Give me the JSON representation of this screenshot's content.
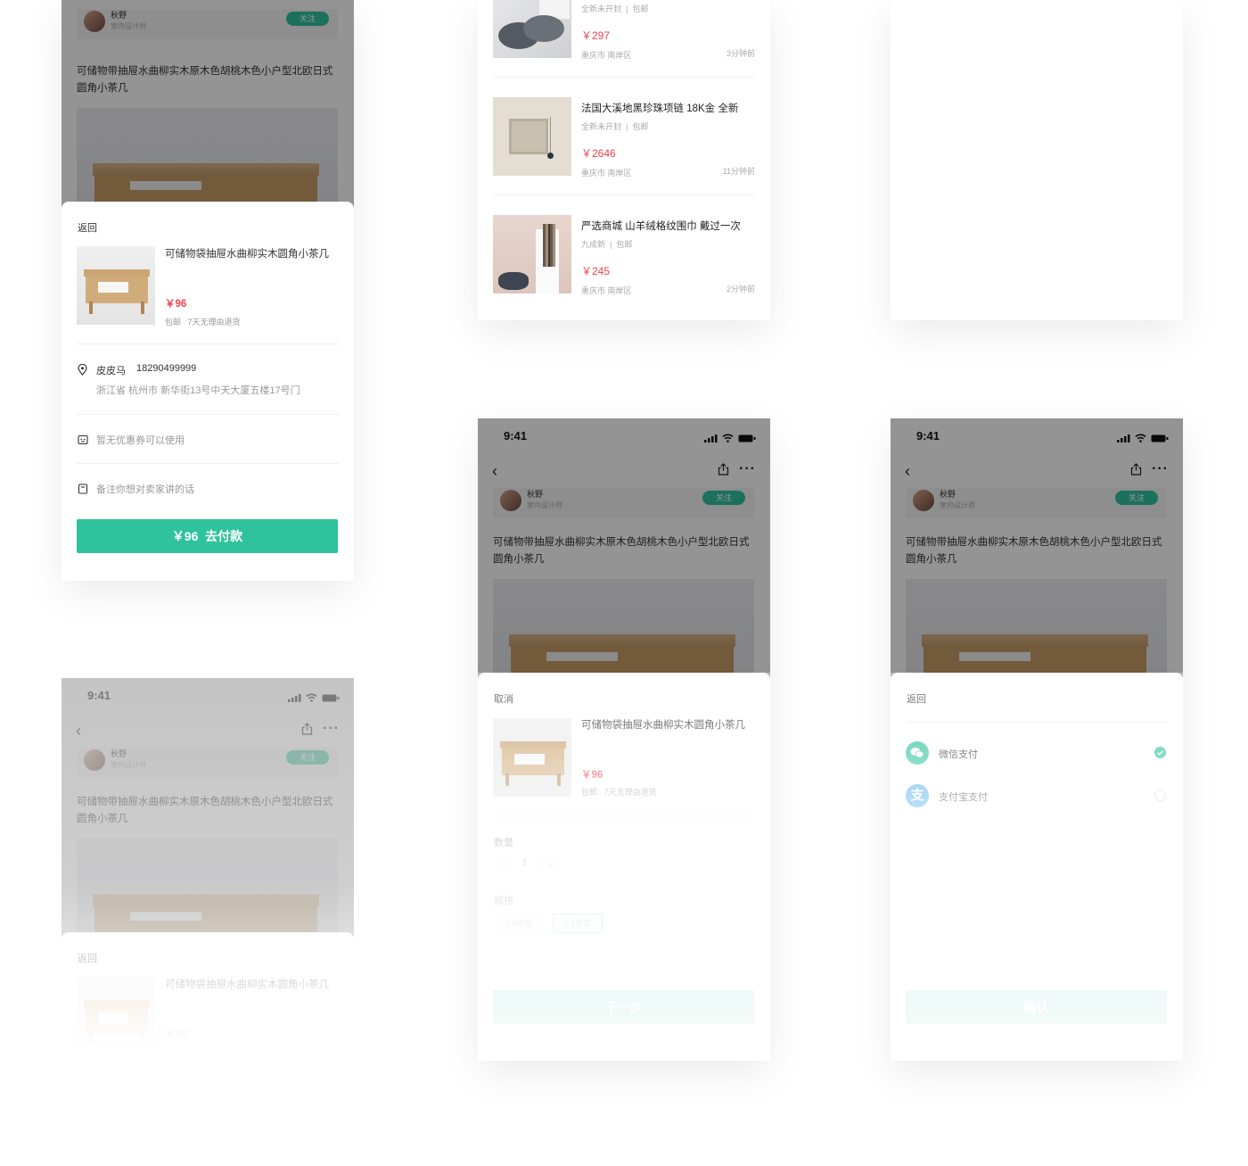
{
  "status_time": "9:41",
  "author": {
    "name": "秋野",
    "role": "室内设计师",
    "follow_label": "关注"
  },
  "product": {
    "title": "可储物带抽屉水曲柳实木原木色胡桃木色小户型北欧日式圆角小茶几",
    "short_title": "可储物袋抽屉水曲柳实木圆角小茶几",
    "price": "￥96",
    "tags": "包邮   7天无理由退货"
  },
  "order_sheet": {
    "back_label": "返回",
    "recipient_name": "皮皮马",
    "recipient_phone": "18290499999",
    "address": "浙江省 杭州市 新华街13号中天大厦五楼17号门",
    "coupon_text": "暂无优惠券可以使用",
    "note_placeholder": "备注你想对卖家讲的话",
    "pay_button": "￥96  去付款"
  },
  "listing": {
    "items": [
      {
        "name": "",
        "condition": "全新未开封  |  包邮",
        "price": "￥297",
        "location": "重庆市 南岸区",
        "ago": "3分钟前"
      },
      {
        "name": "法国大溪地黑珍珠项链 18K金 全新",
        "condition": "全新未开封  |  包邮",
        "price": "￥2646",
        "location": "重庆市 南岸区",
        "ago": "11分钟前"
      },
      {
        "name": "严选商城 山羊绒格纹围巾 戴过一次",
        "condition": "九成新  |  包邮",
        "price": "￥245",
        "location": "重庆市 南岸区",
        "ago": "2分钟前"
      }
    ]
  },
  "spec_sheet": {
    "cancel_label": "取消",
    "quantity_label": "数量",
    "quantity_value": "1",
    "minus": "−",
    "plus": "+",
    "spec_label": "规格",
    "spec_options": [
      "1.8米宽",
      "1.4米宽"
    ],
    "next_button": "下一步"
  },
  "payment_sheet": {
    "back_label": "返回",
    "options": [
      {
        "label": "微信支付",
        "selected": true
      },
      {
        "label": "支付宝支付",
        "selected": false
      }
    ],
    "confirm_button": "确认"
  },
  "colors": {
    "accent": "#2fc39d",
    "price": "#f0414c"
  }
}
